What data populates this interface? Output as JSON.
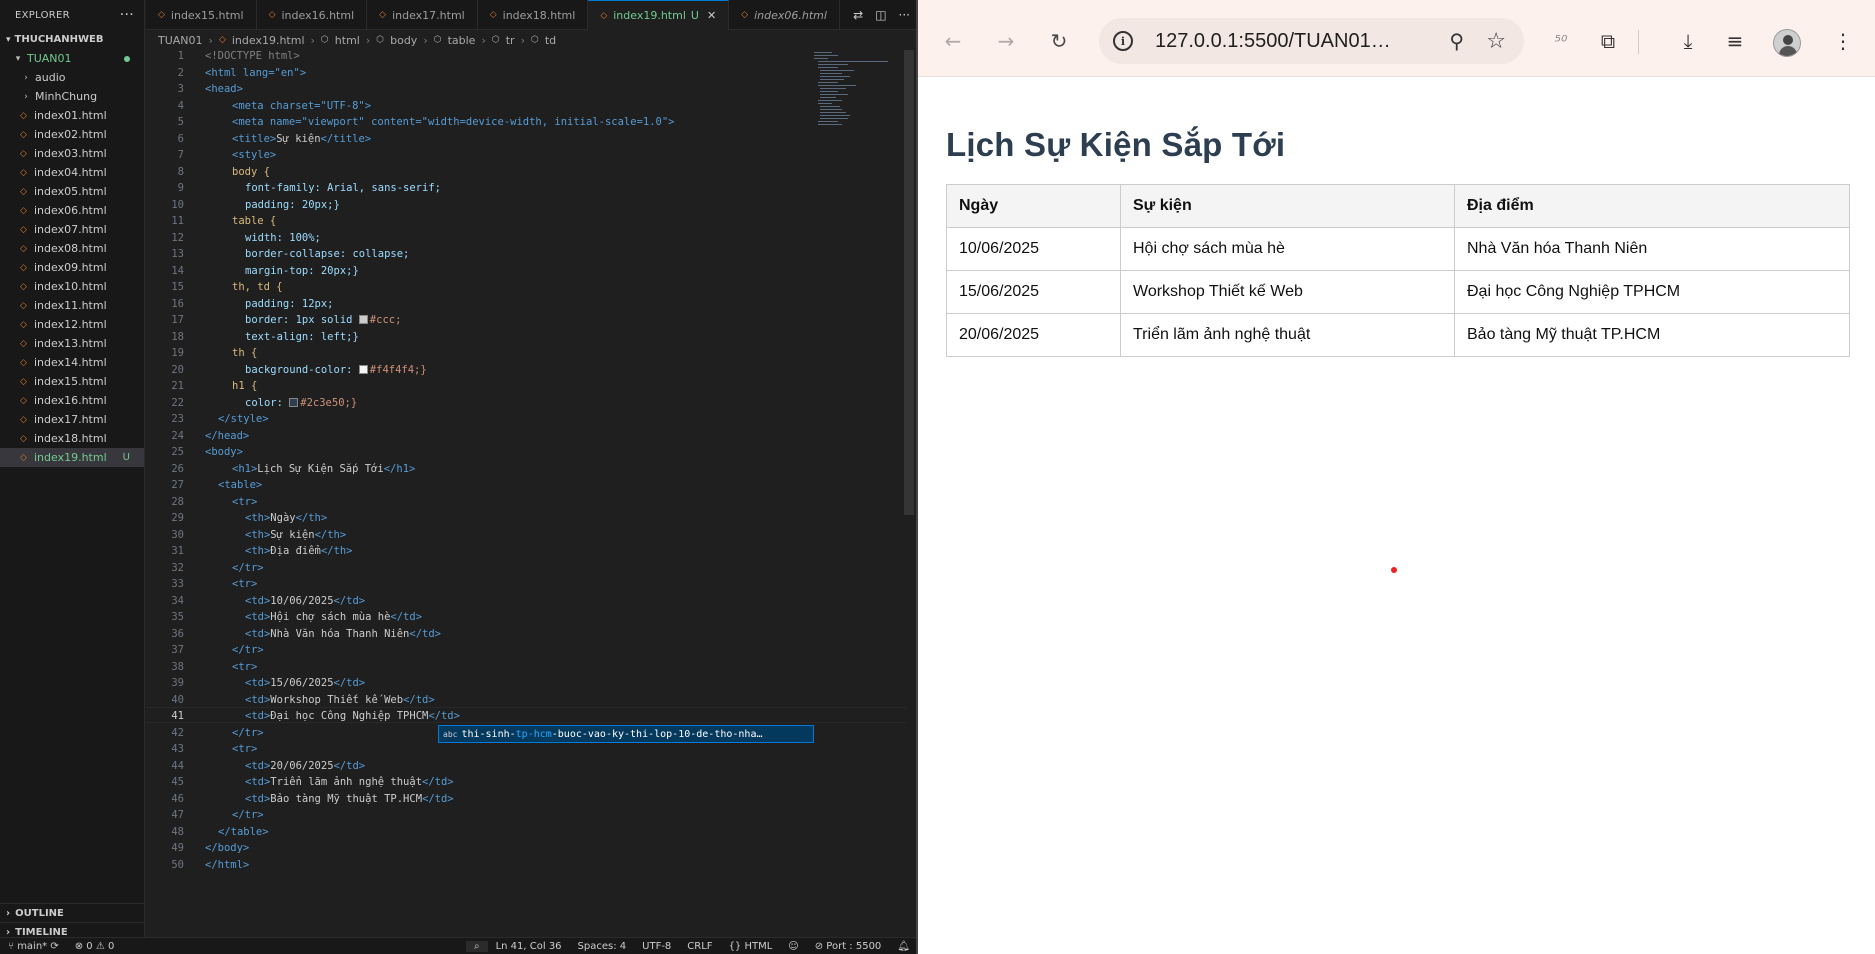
{
  "explorer": {
    "title": "EXPLORER",
    "workspace": "THUCHANHWEB",
    "root": "TUAN01",
    "folders": [
      "audio",
      "MinhChung"
    ],
    "files": [
      "index01.html",
      "index02.html",
      "index03.html",
      "index04.html",
      "index05.html",
      "index06.html",
      "index07.html",
      "index08.html",
      "index09.html",
      "index10.html",
      "index11.html",
      "index12.html",
      "index13.html",
      "index14.html",
      "index15.html",
      "index16.html",
      "index17.html",
      "index18.html",
      "index19.html"
    ],
    "active_file_badge": "U",
    "outline": "OUTLINE",
    "timeline": "TIMELINE"
  },
  "tabs": [
    {
      "label": "index15.html"
    },
    {
      "label": "index16.html"
    },
    {
      "label": "index17.html"
    },
    {
      "label": "index18.html"
    },
    {
      "label": "index19.html",
      "badge": "U"
    },
    {
      "label": "index06.html"
    }
  ],
  "breadcrumb": [
    "TUAN01",
    "index19.html",
    "html",
    "body",
    "table",
    "tr",
    "td"
  ],
  "code_lines": [
    "1",
    "2",
    "3",
    "4",
    "5",
    "6",
    "7",
    "8",
    "9",
    "10",
    "11",
    "12",
    "13",
    "14",
    "15",
    "16",
    "17",
    "18",
    "19",
    "20",
    "21",
    "22",
    "23",
    "24",
    "25",
    "26",
    "27",
    "28",
    "29",
    "30",
    "31",
    "32",
    "33",
    "34",
    "35",
    "36",
    "37",
    "38",
    "39",
    "40",
    "41",
    "42",
    "43",
    "44",
    "45",
    "46",
    "47",
    "48",
    "49",
    "50"
  ],
  "code": {
    "doctype": "<!DOCTYPE html>",
    "html_open": "<html lang=\"en\">",
    "head_open": "<head>",
    "meta_charset": "<meta charset=\"UTF-8\">",
    "meta_viewport": "<meta name=\"viewport\" content=\"width=device-width, initial-scale=1.0\">",
    "title": "Sự kiện",
    "style_open": "<style>",
    "body_sel": "body {",
    "font_family": "font-family: Arial, sans-serif;",
    "padding_body": "padding: 20px;}",
    "table_sel": "table {",
    "width": "width: 100%;",
    "border_collapse": "border-collapse: collapse;",
    "margin_top": "margin-top: 20px;}",
    "thtd_sel": "th, td {",
    "padding_cell": "padding: 12px;",
    "border": "border: 1px solid ",
    "border_color": "#ccc;",
    "text_align": "text-align: left;}",
    "th_sel": "th {",
    "bg_prop": "background-color: ",
    "bg_color": "#f4f4f4;}",
    "h1_sel": "h1 {",
    "color_prop": "color: ",
    "color_val": "#2c3e50;}",
    "style_close": "</style>",
    "head_close": "</head>",
    "body_open": "<body>",
    "h1": "Lịch Sự Kiện Sắp Tới",
    "table_open": "<table>",
    "tr_open": "<tr>",
    "tr_close": "</tr>",
    "table_close": "</table>",
    "body_close": "</body>",
    "html_close": "</html>"
  },
  "suggestion": {
    "abc": "abc",
    "pre": "thi-sinh-",
    "match": "tp-hcm",
    "post": "-buoc-vao-ky-thi-lop-10-de-tho-nha…"
  },
  "statusbar": {
    "branch": "main*",
    "problems": "⊗ 0 ⚠ 0",
    "position": "Ln 41, Col 36",
    "spaces": "Spaces: 4",
    "encoding": "UTF-8",
    "eol": "CRLF",
    "language": "{} HTML",
    "port": "Port : 5500"
  },
  "browser": {
    "url": "127.0.0.1:5500/TUAN01…",
    "page_heading": "Lịch Sự Kiện Sắp Tới",
    "table_headers": [
      "Ngày",
      "Sự kiện",
      "Địa điểm"
    ],
    "table_rows": [
      [
        "10/06/2025",
        "Hội chợ sách mùa hè",
        "Nhà Văn hóa Thanh Niên"
      ],
      [
        "15/06/2025",
        "Workshop Thiết kế Web",
        "Đại học Công Nghiệp TPHCM"
      ],
      [
        "20/06/2025",
        "Triển lãm ảnh nghệ thuật",
        "Bảo tàng Mỹ thuật TP.HCM"
      ]
    ]
  },
  "colors": {
    "heading": "#2c3e50",
    "th_bg": "#f4f4f4",
    "border": "#ccc",
    "git_untracked": "#73c991",
    "accent": "#0078d4"
  }
}
